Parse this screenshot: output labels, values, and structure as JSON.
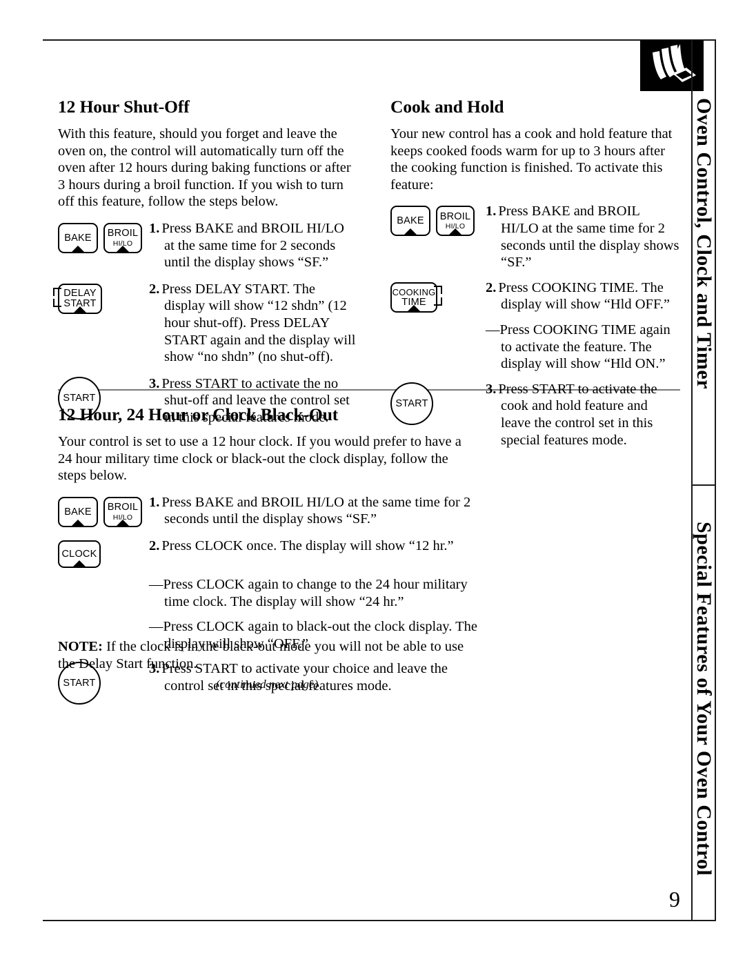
{
  "page": {
    "number": "9",
    "continued_note": "(continued next page)",
    "corner_icon": "hand-pressing-button-icon"
  },
  "sidebar": {
    "tab_upper": "Oven Control, Clock and Timer",
    "tab_lower": "Special Features of Your Oven Control"
  },
  "buttons": {
    "bake": "BAKE",
    "broil_main": "BROIL",
    "broil_sub": "HI/LO",
    "delay_line1": "DELAY",
    "delay_line2": "START",
    "cooking_line1": "COOKING",
    "cooking_line2": "TIME",
    "clock": "CLOCK",
    "start": "START"
  },
  "sections": {
    "shutoff": {
      "heading": "12 Hour Shut-Off",
      "intro": "With this feature, should you forget and leave the oven on, the control will automatically turn off the oven after 12 hours during baking functions or after 3 hours during a broil function. If you wish to turn off this feature, follow the steps below.",
      "steps": [
        {
          "num": "1.",
          "text": "Press BAKE and BROIL HI/LO at the same time for 2 seconds until the display shows “SF.”"
        },
        {
          "num": "2.",
          "text": "Press DELAY START. The display will show “12 shdn” (12 hour shut-off). Press DELAY START again and the display will show “no shdn” (no shut-off)."
        },
        {
          "num": "3.",
          "text": "Press START to activate the no shut-off and leave the control set in this special features mode."
        }
      ]
    },
    "cookhold": {
      "heading": "Cook and Hold",
      "intro": "Your new control has a cook and hold feature that keeps cooked foods warm for up to 3 hours after the cooking function is finished. To activate this feature:",
      "steps": [
        {
          "num": "1.",
          "text": "Press BAKE and BROIL HI/LO at the same time for 2 seconds until the display shows “SF.”"
        },
        {
          "num": "2.",
          "text": "Press COOKING TIME. The display will show “Hld OFF.”"
        },
        {
          "num": "—",
          "text": "Press COOKING TIME again to activate the feature. The display will show “Hld ON.”"
        },
        {
          "num": "3.",
          "text": "Press START to activate the cook and hold feature and leave the control set in this special features mode."
        }
      ]
    },
    "clockmode": {
      "heading": "12 Hour, 24 Hour or Clock Black-Out",
      "intro": "Your control is set to use a 12 hour clock. If you would prefer to have a 24 hour military time clock or black-out the clock display, follow the steps below.",
      "steps": [
        {
          "num": "1.",
          "text": "Press BAKE and BROIL HI/LO at the same time for 2 seconds until the display shows “SF.”"
        },
        {
          "num": "2.",
          "text": "Press CLOCK once. The display will show “12 hr.”"
        },
        {
          "num": "—",
          "text": "Press CLOCK again to change to the 24 hour military time clock. The display will show “24 hr.”"
        },
        {
          "num": "—",
          "text": "Press CLOCK again to black-out the clock display. The display will show “OFF.”"
        },
        {
          "num": "3.",
          "text": "Press START to activate your choice and leave the control set in this special features mode."
        }
      ],
      "note_label": "NOTE:",
      "note_text": " If the clock is in the black-out mode you will not be able to use the Delay Start function."
    }
  }
}
